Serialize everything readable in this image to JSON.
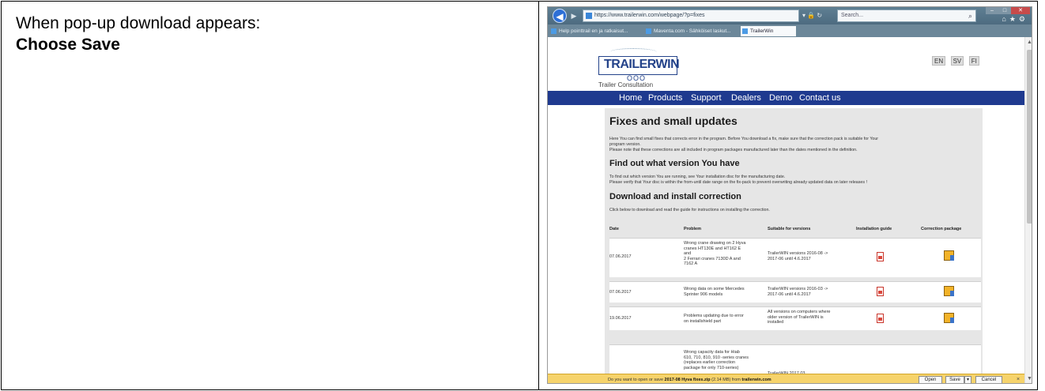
{
  "instruction": {
    "line1": "When pop-up download appears:",
    "line2": "Choose Save"
  },
  "browser": {
    "address": "https://www.trailerwin.com/webpage/?p=fixes",
    "search_placeholder": "Search...",
    "window_buttons": {
      "minimize": "–",
      "maximize": "□",
      "close": "✕"
    },
    "tool_icons": "⌂★⚙",
    "tabs": [
      {
        "label": "Help pointtrail en ja ratkaisut..."
      },
      {
        "label": "Maventa.com - Sähköiset laskut..."
      },
      {
        "label": "TrailerWin"
      }
    ]
  },
  "site": {
    "logo_text": "TRAILERWIN",
    "logo_wheels": "OOO",
    "logo_tagline": "Trailer Consultation",
    "languages": [
      "EN",
      "SV",
      "FI"
    ],
    "nav": [
      "Home",
      "Products",
      "Support",
      "Dealers",
      "Demo",
      "Contact us"
    ],
    "heading": "Fixes and small updates",
    "intro_1": "Here You can find small fixes that corrects error in the program. Before You download a fix, make sure that the correction pack is suitable for Your",
    "intro_2": "program version.",
    "intro_3": "Please note that these corrections are all included in program packages manufactured later than the dates mentioned in the definition.",
    "find_heading": "Find out what version You have",
    "find_1": "To find out which version You are running, see Your installation disc for the manufacturing date.",
    "find_2": "Please verify that Your disc is within the from-until date range on the fix-pack to prevent overwriting already updated data on later releases !",
    "download_heading": "Download and install correction",
    "download_1": "Click below to download and read the guide for instructions on installing the correction.",
    "table": {
      "headers": [
        "Date",
        "Problem",
        "Suitable for versions",
        "Installation guide",
        "Correction package"
      ],
      "rows": [
        {
          "date": "07.06.2017",
          "problem": "Wrong crane drawing on 2 Hyva\ncranes HT130E and HT162 E\nand\n2 Ferrari cranes 7130D A and\n7162 A",
          "versions": "TrailerWIN versions 2016-08 ->\n2017-06 until 4.6.2017"
        },
        {
          "date": "07.06.2017",
          "problem": "Wrong data on some Mercedes\nSprinter 906 models",
          "versions": "TrailerWIN versions 2016-03 ->\n2017-06 until 4.6.2017"
        },
        {
          "date": "19.06.2017",
          "problem": "Problems updating due to error\non installshield part",
          "versions": "All versions on computers where\nolder version of TrailerWIN is\ninstalled"
        },
        {
          "date": "",
          "problem": "Wrong capacity data for Hiab\n610, 710, 810, 910 -series cranes\n(replaces earlier correction\npackage for only 710-series)",
          "versions": "TrailerWIN 2017 03"
        }
      ]
    }
  },
  "download_bar": {
    "prefix": "Do you want to open or save",
    "file": "2017-08 Hyva fixes.zip",
    "size": "(2.14 MB) from",
    "source": "trailerwin.com",
    "open_label": "Open",
    "save_label": "Save",
    "save_menu": "▾",
    "cancel_label": "Cancel",
    "close_label": "×"
  },
  "colors": {
    "nav_bg": "#1f3a8f",
    "logo": "#24438a",
    "content_bg": "#e6e6e6",
    "download_bar": "#f6d36b"
  }
}
